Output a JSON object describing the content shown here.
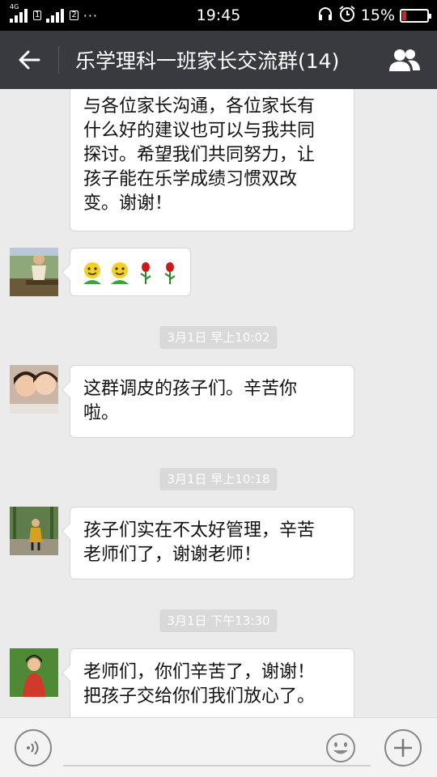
{
  "status_bar": {
    "network": "4G",
    "sim_1": "1",
    "sim_2": "2",
    "more": "···",
    "time": "19:45",
    "battery": "15%",
    "battery_level": 0.15
  },
  "header": {
    "title": "乐学理科一班家长交流群(14)"
  },
  "messages": [
    {
      "type": "text",
      "lines": [
        "与各位家长沟通，各位家长有",
        "什么好的建议也可以与我共同",
        "探讨。希望我们共同努力，让",
        "孩子能在乐学成绩习惯双改",
        "变。谢谢！"
      ]
    },
    {
      "type": "emoji",
      "emojis": [
        "smiley-emoji",
        "smiley-emoji",
        "rose-emoji",
        "rose-emoji"
      ]
    },
    {
      "type": "time",
      "text": "3月1日 早上10:02"
    },
    {
      "type": "text",
      "lines": [
        "这群调皮的孩子们。辛苦你",
        "啦。"
      ]
    },
    {
      "type": "time",
      "text": "3月1日 早上10:18"
    },
    {
      "type": "text",
      "lines": [
        "孩子们实在不太好管理，辛苦",
        "老师们了，谢谢老师！"
      ]
    },
    {
      "type": "time",
      "text": "3月1日 下午13:30"
    },
    {
      "type": "text",
      "lines": [
        "老师们，你们辛苦了，谢谢！",
        "把孩子交给你们我们放心了。"
      ]
    }
  ],
  "colors": {
    "title_bar": "#393a3f",
    "chat_bg": "#ebebeb",
    "bubble": "#ffffff",
    "time_pill": "#d9d9d9"
  }
}
